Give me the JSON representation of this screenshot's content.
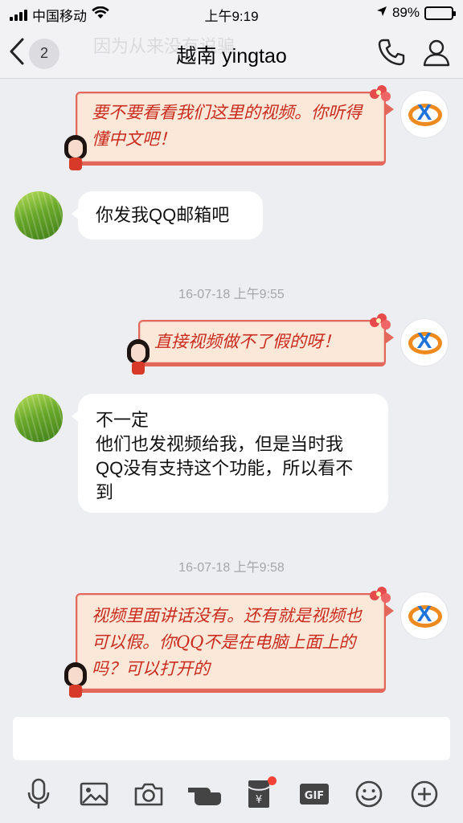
{
  "status_bar": {
    "carrier": "中国移动",
    "time": "上午9:19",
    "battery_percent": "89%",
    "battery_level": 0.89
  },
  "nav": {
    "unread_count": "2",
    "preview_text": "因为从来没有说骗",
    "title": "越南 yingtao"
  },
  "messages": [
    {
      "side": "right",
      "style": "red-theme",
      "text": "要不要看看我们这里的视频。你听得懂中文吧！"
    },
    {
      "side": "left",
      "style": "white",
      "text": "你发我QQ邮箱吧"
    },
    {
      "type": "timestamp",
      "text": "16-07-18 上午9:55"
    },
    {
      "side": "right",
      "style": "red-theme",
      "text": "直接视频做不了假的呀！"
    },
    {
      "side": "left",
      "style": "white",
      "lines": [
        "不一定",
        "他们也发视频给我，但是当时我QQ没有支持这个功能，所以看不到"
      ]
    },
    {
      "type": "timestamp",
      "text": "16-07-18 上午9:58"
    },
    {
      "side": "right",
      "style": "red-theme",
      "text": "视频里面讲话没有。还有就是视频也可以假。你QQ不是在电脑上面上的吗？可以打开的"
    }
  ],
  "input": {
    "value": ""
  },
  "toolbar": {
    "items": [
      "microphone-icon",
      "image-icon",
      "camera-icon",
      "hand-gesture-icon",
      "red-packet-icon",
      "gif-icon",
      "emoji-icon",
      "plus-icon"
    ],
    "gif_label": "GIF",
    "red_packet_symbol": "¥"
  },
  "colors": {
    "background": "#edeef2",
    "red_bubble_text": "#c92b1e",
    "red_bubble_border": "#e3675a",
    "red_bubble_fill": "#fbe8d9"
  }
}
